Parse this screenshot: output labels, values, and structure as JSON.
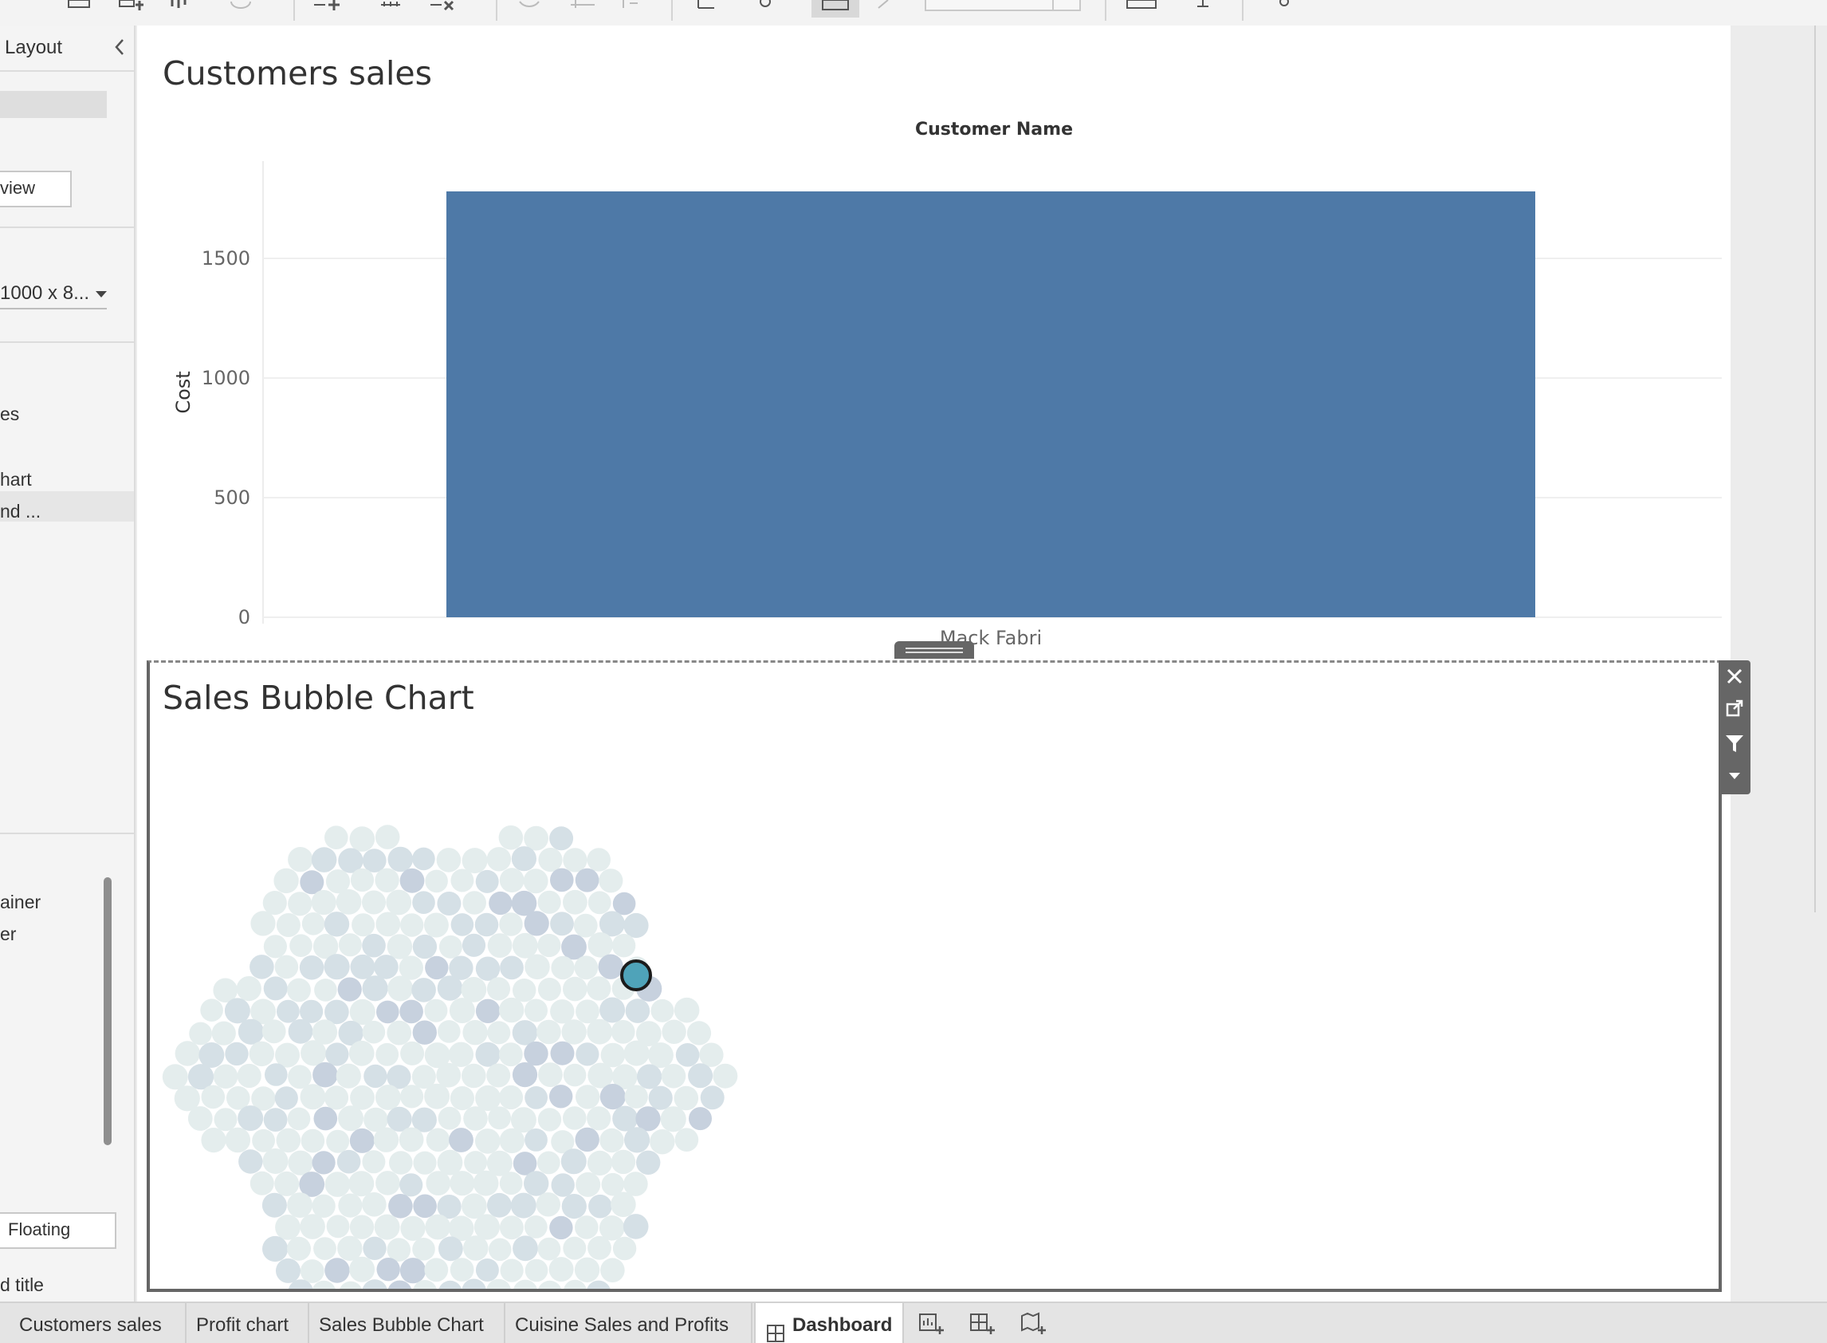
{
  "left_panel": {
    "title": "Layout",
    "preview_button": "view",
    "size_value": "1000 x 8...",
    "items": [
      "es",
      "hart",
      "nd ..."
    ],
    "objects": [
      "ainer",
      "er"
    ],
    "floating_button": "Floating",
    "title_option": "d title"
  },
  "dashboard": {
    "bar_zone": {
      "title": "Customers sales",
      "header": "Customer Name"
    },
    "bubble_zone": {
      "title": "Sales Bubble Chart"
    }
  },
  "tabs": [
    {
      "label": "Customers sales"
    },
    {
      "label": "Profit chart"
    },
    {
      "label": "Sales Bubble Chart"
    },
    {
      "label": "Cuisine Sales and Profits"
    },
    {
      "label": "Dashboard"
    }
  ],
  "colors": {
    "bar": "#4e79a7",
    "bubble_light": "#e4eded",
    "bubble_mid": "#d5e0e6",
    "bubble_dark": "#c7d1de",
    "bubble_highlight": "#4fa3b9"
  },
  "chart_data": [
    {
      "type": "bar",
      "title": "Customers sales",
      "header": "Customer Name",
      "categories": [
        "Mack Fabri"
      ],
      "values": [
        1780
      ],
      "xlabel": "",
      "ylabel": "Cost",
      "ylim": [
        0,
        1850
      ],
      "yticks": [
        "0",
        "500",
        "1000",
        "1500"
      ]
    },
    {
      "type": "scatter",
      "subtype": "packed-bubble",
      "title": "Sales Bubble Chart",
      "bubble_count": 300,
      "highlighted_bubbles": 1
    }
  ]
}
